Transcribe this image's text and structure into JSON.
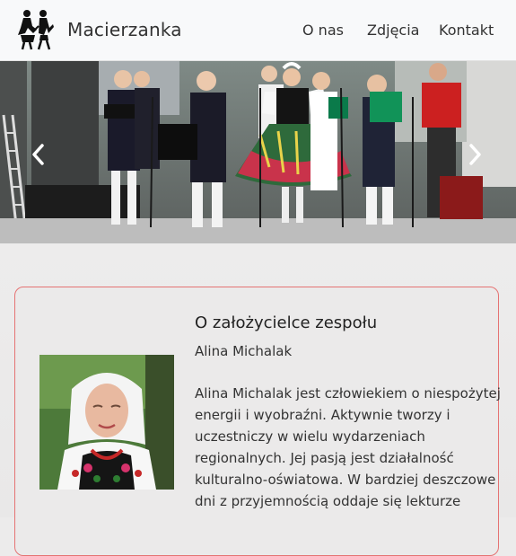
{
  "brand": {
    "name": "Macierzanka",
    "logo_icon": "folk-dancers-icon"
  },
  "nav": {
    "items": [
      "O nas",
      "Zdjęcia",
      "Kontakt"
    ]
  },
  "carousel": {
    "prev_icon": "chevron-left-icon",
    "next_icon": "chevron-right-icon"
  },
  "founder": {
    "title": "O założycielce zespołu",
    "name": "Alina Michalak",
    "bio_lines": [
      "Alina Michalak jest człowiekiem o niespożytej",
      "energii i wyobraźni. Aktywnie tworzy i",
      "uczestniczy w wielu wydarzeniach",
      "regionalnych. Jej pasją jest działalność",
      "kulturalno-oświatowa. W bardziej deszczowe",
      "dni z przyjemnością oddaje się lekturze"
    ]
  },
  "colors": {
    "card_border": "#e57373",
    "navbar_bg": "#f8f9fa"
  }
}
